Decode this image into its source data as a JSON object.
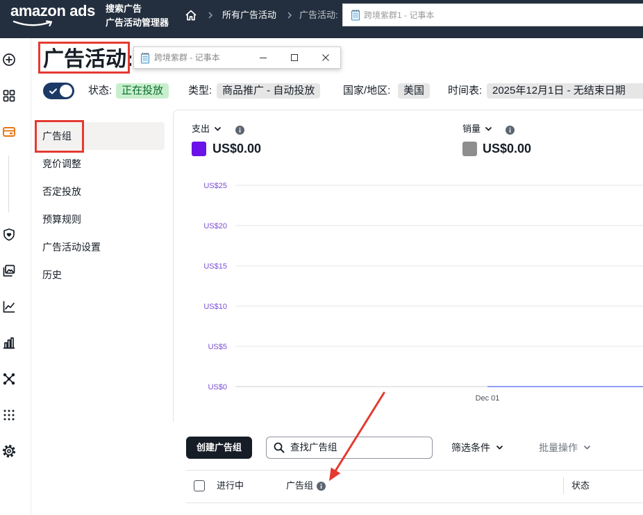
{
  "topbar": {
    "logo": "amazon ads",
    "product_line1": "搜索广告",
    "product_line2": "广告活动管理器",
    "breadcrumb": {
      "all_campaigns": "所有广告活动",
      "current": "广告活动:"
    },
    "notepad_tab_title": "跨境紫群1 - 记事本",
    "icons": [
      "amazon-smile-icon",
      "home-icon",
      "chevron-right-icon",
      "notepad-icon"
    ]
  },
  "rail": {
    "icons": [
      "add-circle-icon",
      "dashboard-grid-icon",
      "campaigns-icon",
      "shield-icon",
      "images-icon",
      "line-chart-icon",
      "bar-chart-icon",
      "network-icon",
      "apps-grid-icon",
      "settings-gear-icon"
    ],
    "active": "campaigns-icon"
  },
  "notepad_window": {
    "title": "跨境紫群 - 记事本",
    "icons": [
      "minimize-icon",
      "maximize-icon",
      "close-icon"
    ]
  },
  "campaign": {
    "title": "广告活动:",
    "enabled": true,
    "status_label": "状态:",
    "status": "正在投放",
    "type_label": "类型:",
    "type": "商品推广 - 自动投放",
    "country_label": "国家/地区:",
    "country": "美国",
    "schedule_label": "时间表:",
    "schedule": "2025年12月1日 - 无结束日期"
  },
  "subnav": {
    "items": [
      {
        "label": "广告组",
        "selected": true
      },
      {
        "label": "竞价调整",
        "selected": false
      },
      {
        "label": "否定投放",
        "selected": false
      },
      {
        "label": "预算规则",
        "selected": false
      },
      {
        "label": "广告活动设置",
        "selected": false
      },
      {
        "label": "历史",
        "selected": false
      }
    ]
  },
  "metrics": [
    {
      "label": "支出",
      "value": "US$0.00",
      "color": "#6b12e8"
    },
    {
      "label": "销量",
      "value": "US$0.00",
      "color": "#8e8e8e"
    }
  ],
  "chart_data": {
    "type": "line",
    "ylim": [
      0,
      25
    ],
    "y_ticks": [
      {
        "value": 25,
        "label": "US$25"
      },
      {
        "value": 20,
        "label": "US$20"
      },
      {
        "value": 15,
        "label": "US$15"
      },
      {
        "value": 10,
        "label": "US$10"
      },
      {
        "value": 5,
        "label": "US$5"
      },
      {
        "value": 0,
        "label": "US$0"
      }
    ],
    "x_ticks": [
      "Dec 01"
    ],
    "grid": true,
    "series": [
      {
        "x": [
          "Dec 01"
        ],
        "values": [
          0
        ],
        "color": "#6f7ff5"
      }
    ]
  },
  "toolbar": {
    "create_button": "创建广告组",
    "search_placeholder": "查找广告组",
    "filter": "筛选条件",
    "bulk_actions": "批量操作"
  },
  "table": {
    "columns": {
      "active": "进行中",
      "ad_group": "广告组",
      "status": "状态"
    }
  },
  "colors": {
    "topbar_bg": "#232f3e",
    "active_rail_icon": "#e87511",
    "toggle_on": "#1c3a66",
    "status_badge_bg": "#c7efcd",
    "status_badge_text": "#0d6b2b",
    "chip_bg": "#e6e6e6",
    "annotation_red": "#e53a31",
    "axis_label": "#7a4ed2",
    "primary_button": "#161d26"
  }
}
